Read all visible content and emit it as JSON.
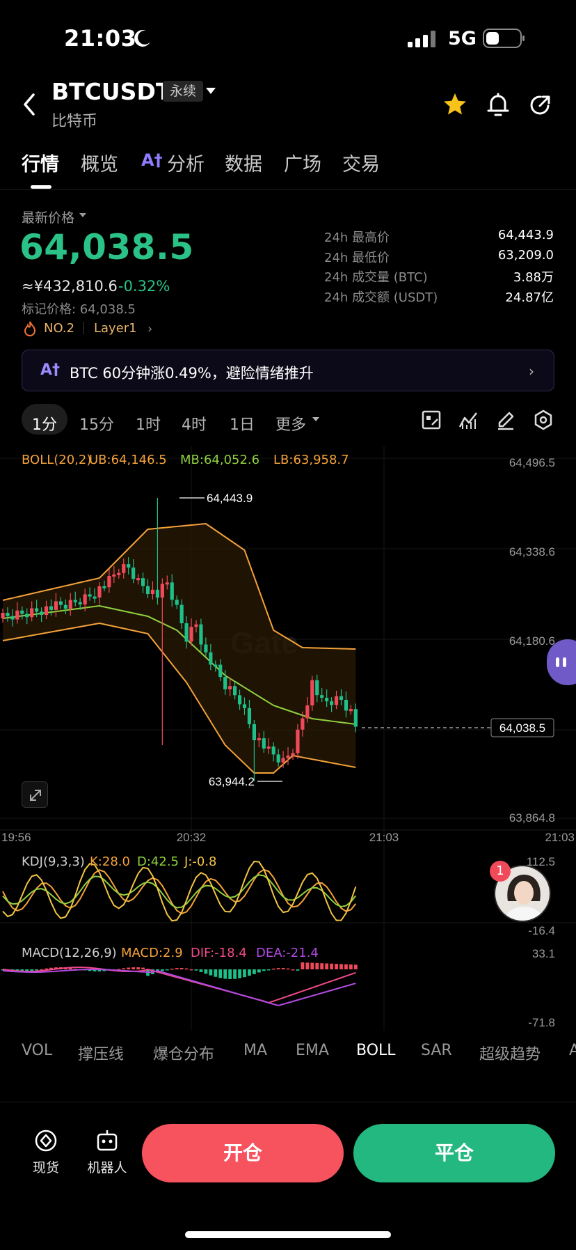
{
  "status_bar": {
    "time": "21:03",
    "network": "5G"
  },
  "header": {
    "symbol": "BTCUSDT",
    "contract_type": "永续",
    "coin_name": "比特币"
  },
  "tabs": [
    {
      "label": "行情",
      "active": true
    },
    {
      "label": "概览"
    },
    {
      "label": "分析",
      "ai": "A†"
    },
    {
      "label": "数据"
    },
    {
      "label": "广场"
    },
    {
      "label": "交易"
    }
  ],
  "price": {
    "latest_label": "最新价格",
    "last": "64,038.5",
    "cny": "≈¥432,810.6",
    "change": "-0.32%",
    "mark": "标记价格: 64,038.5",
    "rank": "NO.2",
    "sector": "Layer1"
  },
  "stats": [
    {
      "label": "24h 最高价",
      "value": "64,443.9"
    },
    {
      "label": "24h 最低价",
      "value": "63,209.0"
    },
    {
      "label": "24h 成交量 (BTC)",
      "value": "3.88万"
    },
    {
      "label": "24h 成交额 (USDT)",
      "value": "24.87亿"
    }
  ],
  "ai_banner": {
    "icon": "A†",
    "text": "BTC 60分钟涨0.49%，避险情绪推升"
  },
  "timeframes": [
    "1分",
    "15分",
    "1时",
    "4时",
    "1日",
    "更多"
  ],
  "chart": {
    "boll_label": "BOLL(20,2)",
    "ub_label": "UB:64,146.5",
    "mb_label": "MB:64,052.6",
    "lb_label": "LB:63,958.7",
    "y_ticks": [
      "64,496.5",
      "64,338.6",
      "64,180.6",
      "63,864.8"
    ],
    "current_price": "64,038.5",
    "high_marker": "64,443.9",
    "low_marker": "63,944.2",
    "x_ticks": [
      "19:56",
      "20:32",
      "21:03",
      "21:03"
    ],
    "watermark": "Gate",
    "kdj_label": "KDJ(9,3,3)",
    "k_label": "K:28.0",
    "d_label": "D:42.5",
    "j_label": "J:-0.8",
    "kdj_ticks": [
      "112.5",
      "-16.4"
    ],
    "macd_label": "MACD(12,26,9)",
    "macd_value": "MACD:2.9",
    "dif_value": "DIF:-18.4",
    "dea_value": "DEA:-21.4",
    "macd_ticks": [
      "33.1",
      "-71.8"
    ],
    "colors": {
      "up": "#f04a5a",
      "down": "#1fbf8a",
      "ub": "#f4a23a",
      "mb": "#8fd13f",
      "lb": "#f4a23a",
      "k": "#f4a23a",
      "d": "#8fd13f",
      "j": "#f4c542",
      "dif": "#f04a8a",
      "dea": "#b04ae0"
    }
  },
  "indicators": [
    "VOL",
    "撑压线",
    "爆仓分布",
    "MA",
    "EMA",
    "BOLL",
    "SAR",
    "超级趋势",
    "A"
  ],
  "active_indicator": "BOLL",
  "assistant": {
    "badge": "1"
  },
  "bottom_bar": {
    "spot": "现货",
    "robot": "机器人",
    "open": "开仓",
    "close": "平仓"
  }
}
